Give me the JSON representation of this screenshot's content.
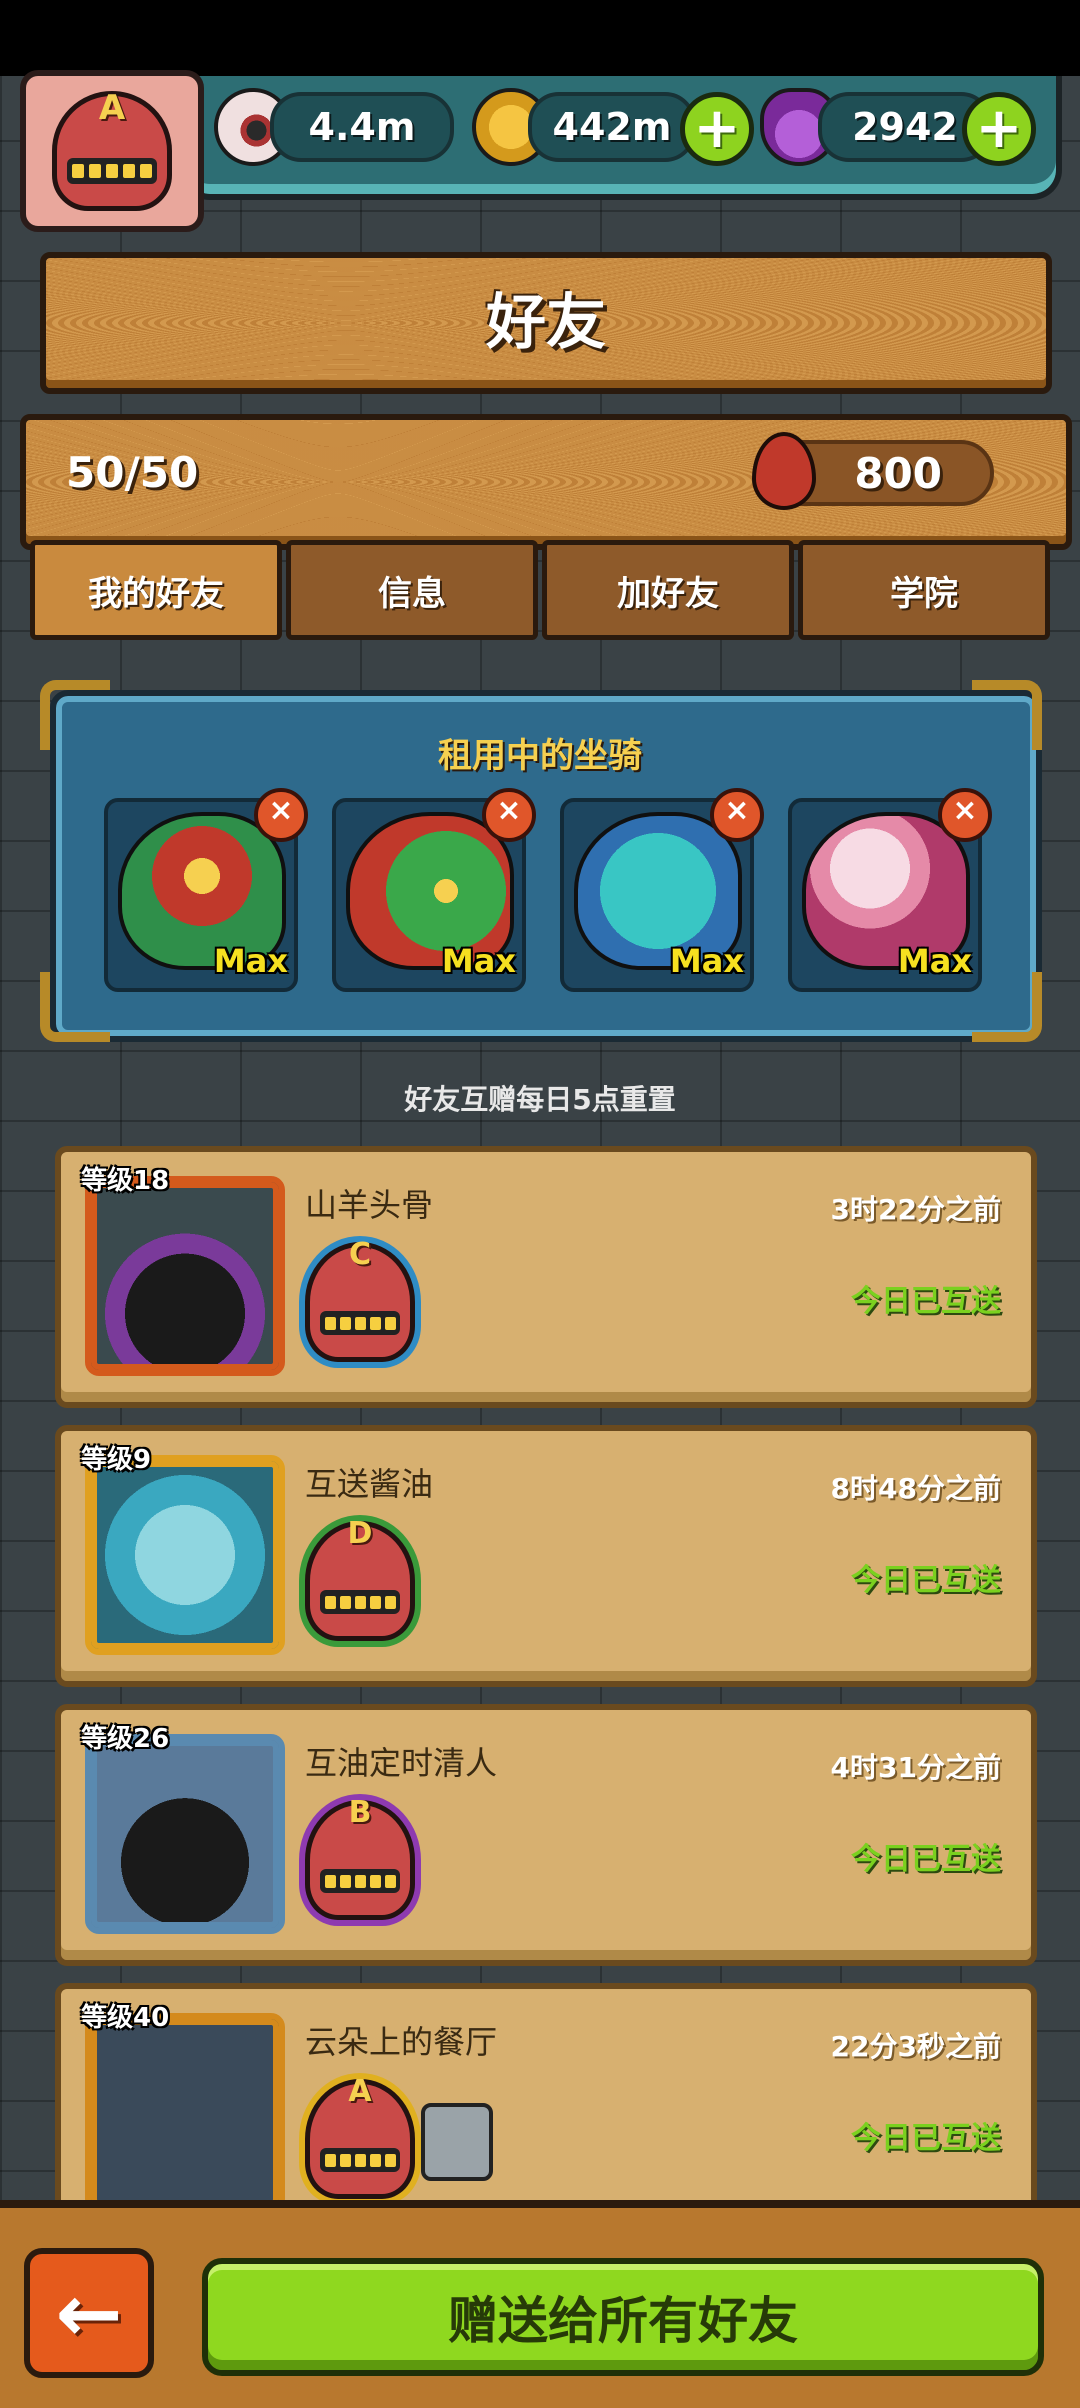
{
  "header": {
    "player_rank": "A",
    "resources": [
      {
        "icon": "eyeball-icon",
        "value": "4.4m",
        "addable": false
      },
      {
        "icon": "coin-icon",
        "value": "442m",
        "addable": true
      },
      {
        "icon": "potion-icon",
        "value": "2942",
        "addable": true
      }
    ]
  },
  "title": "好友",
  "friend_count": "50/50",
  "blood_points": "800",
  "tabs": [
    "我的好友",
    "信息",
    "加好友",
    "学院"
  ],
  "active_tab": "我的好友",
  "mounts": {
    "title": "租用中的坐骑",
    "items": [
      {
        "icon": "lion-dance-mount-icon",
        "level": "Max",
        "color": "#c0392b"
      },
      {
        "icon": "green-dragon-mount-icon",
        "level": "Max",
        "color": "#3aa84a"
      },
      {
        "icon": "cyan-bird-mount-icon",
        "level": "Max",
        "color": "#39c6c4"
      },
      {
        "icon": "cherry-blossom-mount-icon",
        "level": "Max",
        "color": "#e58aa8"
      }
    ]
  },
  "reset_note": "好友互赠每日5点重置",
  "friends": [
    {
      "level": "等级18",
      "name": "山羊头骨",
      "time": "3时22分之前",
      "status": "今日已互送",
      "rank": "C",
      "rank_color": "#2f8cc4",
      "avatar": "purple-beanie-avatar",
      "frame_color": "#d45a1c"
    },
    {
      "level": "等级9",
      "name": "互送酱油",
      "time": "8时48分之前",
      "status": "今日已互送",
      "rank": "D",
      "rank_color": "#3a9a3a",
      "avatar": "bubble-fish-avatar",
      "frame_color": "#e0a020"
    },
    {
      "level": "等级26",
      "name": "互油定时清人",
      "time": "4时31分之前",
      "status": "今日已互送",
      "rank": "B",
      "rank_color": "#8e3ab0",
      "avatar": "black-mouse-avatar",
      "frame_color": "#5a8ab0"
    },
    {
      "level": "等级40",
      "name": "云朵上的餐厅",
      "time": "22分3秒之前",
      "status": "今日已互送",
      "rank": "A",
      "rank_color": "#c94a48",
      "avatar": "tic-tac-toe-avatar",
      "frame_color": "#d48a1c",
      "has_robot": true
    }
  ],
  "bottom": {
    "back_icon": "arrow-left-icon",
    "gift_all_label": "赠送给所有好友"
  }
}
